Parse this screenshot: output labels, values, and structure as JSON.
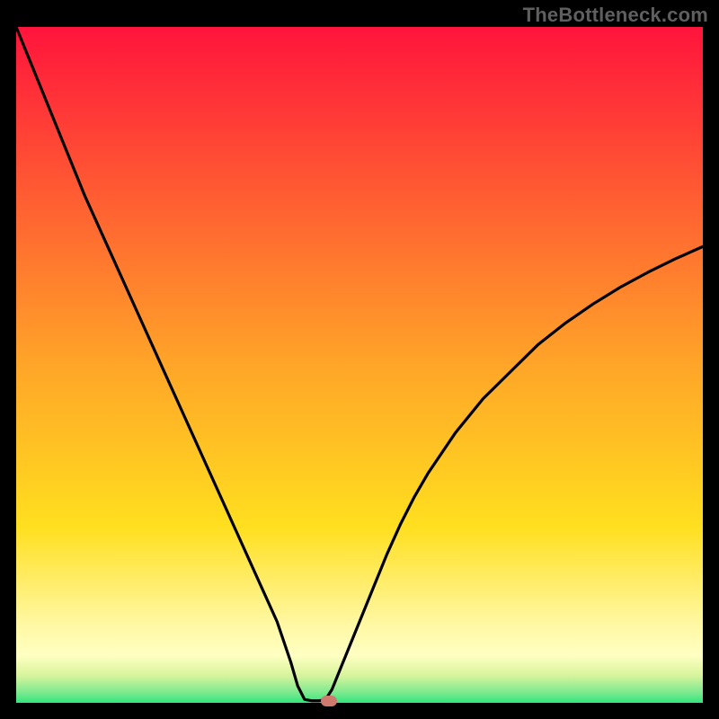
{
  "watermark": {
    "text": "TheBottleneck.com"
  },
  "colors": {
    "top": "#ff143c",
    "mid": "#ffdf1f",
    "pale": "#ffffc2",
    "green": "#32e67d",
    "curve": "#000000",
    "marker": "#cf7a6f"
  },
  "chart_data": {
    "type": "line",
    "title": "",
    "xlabel": "",
    "ylabel": "",
    "xlim": [
      0,
      100
    ],
    "ylim": [
      0,
      100
    ],
    "x": [
      0,
      2,
      4,
      6,
      8,
      10,
      12,
      14,
      16,
      18,
      20,
      22,
      24,
      26,
      28,
      30,
      32,
      34,
      36,
      38,
      40,
      41,
      42,
      43,
      44,
      45,
      46,
      48,
      50,
      52,
      54,
      56,
      58,
      60,
      64,
      68,
      72,
      76,
      80,
      84,
      88,
      92,
      96,
      100
    ],
    "values": [
      100,
      95,
      90,
      85,
      80,
      75,
      70.5,
      66,
      61.5,
      57,
      52.5,
      48,
      43.5,
      39,
      34.5,
      30,
      25.5,
      21,
      16.5,
      12,
      6,
      2.5,
      0.5,
      0.3,
      0.3,
      0.4,
      2,
      7,
      12,
      17,
      22,
      26.5,
      30.5,
      34,
      40,
      45,
      49,
      53,
      56.2,
      59,
      61.5,
      63.7,
      65.7,
      67.5
    ],
    "flat_start_x": 42,
    "flat_end_x": 45,
    "marker": {
      "x": 45.5,
      "y": 0.3
    },
    "grid": false,
    "legend": null
  }
}
